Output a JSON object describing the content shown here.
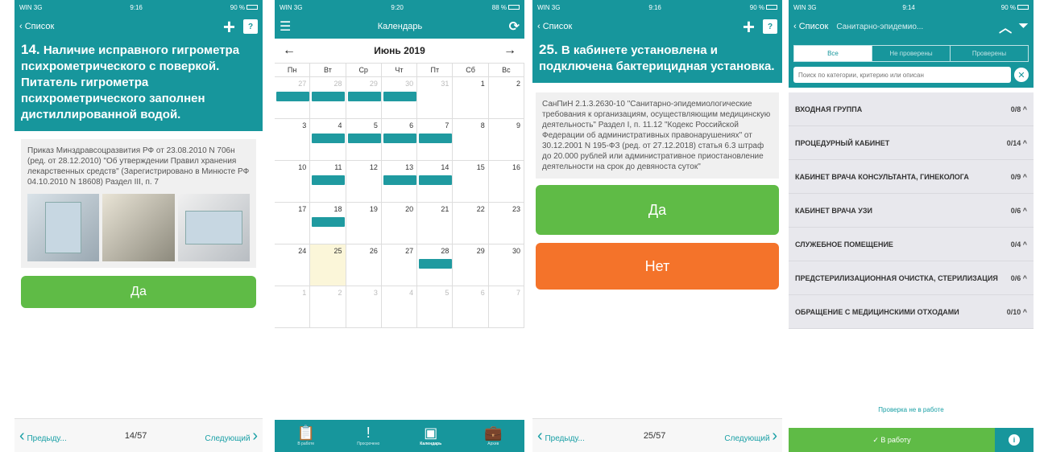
{
  "status": {
    "p1": {
      "carrier": "WIN 3G",
      "time": "9:16",
      "battery": "90 %"
    },
    "p2": {
      "carrier": "WIN 3G",
      "time": "9:20",
      "battery": "88 %"
    },
    "p3": {
      "carrier": "WIN 3G",
      "time": "9:16",
      "battery": "90 %"
    },
    "p4": {
      "carrier": "WIN 3G",
      "time": "9:14",
      "battery": "90 %"
    }
  },
  "screen1": {
    "back_label": "Список",
    "help_label": "?",
    "question_number": "14.",
    "question_text": "Наличие исправного гигрометра психрометрического с поверкой. Питатель гигрометра психрометрического заполнен дистиллированной водой.",
    "reference": "Приказ Минздравсоцразвития РФ от 23.08.2010 N 706н (ред. от 28.12.2010) \"Об утверждении Правил хранения лекарственных средств\" (Зарегистрировано в Минюсте РФ 04.10.2010 N 18608) Раздел III, п. 7",
    "yes_label": "Да",
    "prev_label": "Предыду...",
    "counter": "14/57",
    "next_label": "Следующий"
  },
  "screen2": {
    "title": "Календарь",
    "month": "Июнь 2019",
    "weekdays": [
      "Пн",
      "Вт",
      "Ср",
      "Чт",
      "Пт",
      "Сб",
      "Вс"
    ],
    "weeks": [
      [
        "27",
        "28",
        "29",
        "30",
        "31",
        "1",
        "2"
      ],
      [
        "3",
        "4",
        "5",
        "6",
        "7",
        "8",
        "9"
      ],
      [
        "10",
        "11",
        "12",
        "13",
        "14",
        "15",
        "16"
      ],
      [
        "17",
        "18",
        "19",
        "20",
        "21",
        "22",
        "23"
      ],
      [
        "24",
        "25",
        "26",
        "27",
        "28",
        "29",
        "30"
      ],
      [
        "1",
        "2",
        "3",
        "4",
        "5",
        "6",
        "7"
      ]
    ],
    "tabs": [
      {
        "label": "В работе",
        "icon": "clipboard-icon"
      },
      {
        "label": "Просрочено",
        "icon": "exclamation-icon"
      },
      {
        "label": "Календарь",
        "icon": "calendar-icon"
      },
      {
        "label": "Архив",
        "icon": "briefcase-icon"
      }
    ]
  },
  "screen3": {
    "back_label": "Список",
    "help_label": "?",
    "question_number": "25.",
    "question_text": "В кабинете установлена и подключена бактерицидная установка.",
    "reference": "СанПиН 2.1.3.2630-10 \"Санитарно-эпидемиологические требования к организациям, осуществляющим медицинскую деятельность\" Раздел I, п. 11.12 \"Кодекс Российской Федерации об административных правонарушениях\" от 30.12.2001 N 195-ФЗ (ред. от 27.12.2018) статья 6.3 штраф до 20.000 рублей или административное приостановление деятельности на срок до девяноста суток\"",
    "yes_label": "Да",
    "no_label": "Нет",
    "prev_label": "Предыду...",
    "counter": "25/57",
    "next_label": "Следующий"
  },
  "screen4": {
    "back_label": "Список",
    "title": "Санитарно-эпидемио...",
    "segments": [
      "Все",
      "Не проверены",
      "Проверены"
    ],
    "search_placeholder": "Поиск по категории, критерию или описан",
    "items": [
      {
        "name": "ВХОДНАЯ ГРУППА",
        "count": "0/8"
      },
      {
        "name": "ПРОЦЕДУРНЫЙ КАБИНЕТ",
        "count": "0/14"
      },
      {
        "name": "КАБИНЕТ ВРАЧА КОНСУЛЬТАНТА, ГИНЕКОЛОГА",
        "count": "0/9"
      },
      {
        "name": "КАБИНЕТ ВРАЧА УЗИ",
        "count": "0/6"
      },
      {
        "name": "СЛУЖЕБНОЕ ПОМЕЩЕНИЕ",
        "count": "0/4"
      },
      {
        "name": "ПРЕДСТЕРИЛИЗАЦИОННАЯ ОЧИСТКА, СТЕРИЛИЗАЦИЯ",
        "count": "0/6"
      },
      {
        "name": "ОБРАЩЕНИЕ С МЕДИЦИНСКИМИ ОТХОДАМИ",
        "count": "0/10"
      }
    ],
    "status_note": "Проверка не в работе",
    "work_label": "В работу",
    "info_label": "i"
  },
  "colors": {
    "teal": "#17969c",
    "green": "#5fbb46",
    "orange": "#f4732a",
    "today": "#fbf6d9"
  }
}
